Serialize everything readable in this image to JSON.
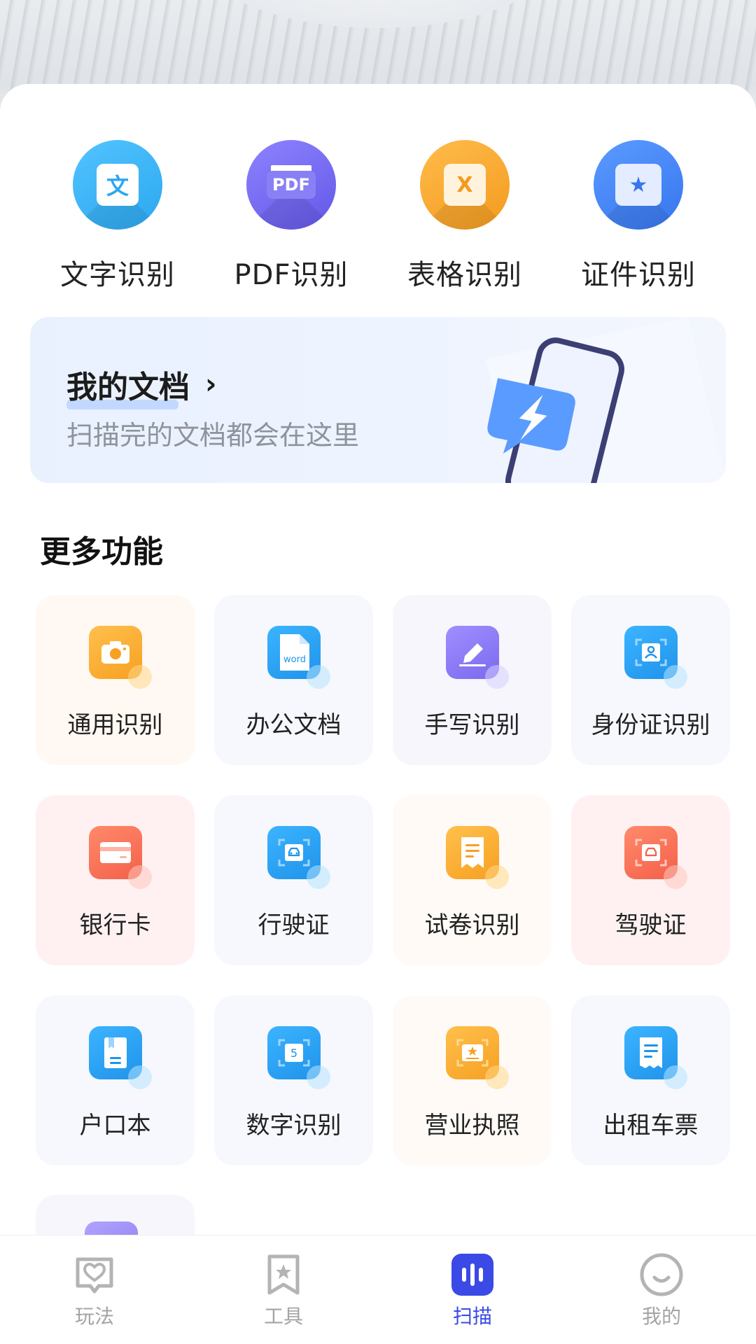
{
  "top_actions": [
    {
      "label": "文字识别",
      "icon": "text-recognition-icon",
      "glyph": "文",
      "color": "#2ca7f0"
    },
    {
      "label": "PDF识别",
      "icon": "pdf-recognition-icon",
      "glyph": "PDF",
      "color": "#6357e6"
    },
    {
      "label": "表格识别",
      "icon": "table-recognition-icon",
      "glyph": "X",
      "color": "#f39a1e"
    },
    {
      "label": "证件识别",
      "icon": "id-recognition-icon",
      "glyph": "★",
      "color": "#3675ee"
    }
  ],
  "my_docs": {
    "title": "我的文档",
    "chevron": "›",
    "subtitle": "扫描完的文档都会在这里"
  },
  "more_section": {
    "title": "更多功能",
    "items": [
      {
        "label": "通用识别",
        "icon": "camera-icon"
      },
      {
        "label": "办公文档",
        "icon": "word-document-icon",
        "badge": "word"
      },
      {
        "label": "手写识别",
        "icon": "pen-edit-icon"
      },
      {
        "label": "身份证识别",
        "icon": "id-card-icon"
      },
      {
        "label": "银行卡",
        "icon": "bank-card-icon"
      },
      {
        "label": "行驶证",
        "icon": "vehicle-license-icon"
      },
      {
        "label": "试卷识别",
        "icon": "exam-paper-icon"
      },
      {
        "label": "驾驶证",
        "icon": "driver-license-icon"
      },
      {
        "label": "户口本",
        "icon": "household-book-icon"
      },
      {
        "label": "数字识别",
        "icon": "number-recognition-icon",
        "badge": "5"
      },
      {
        "label": "营业执照",
        "icon": "business-license-icon"
      },
      {
        "label": "出租车票",
        "icon": "taxi-receipt-icon"
      }
    ]
  },
  "bottom_nav": [
    {
      "label": "玩法",
      "icon": "heart-message-icon",
      "active": false
    },
    {
      "label": "工具",
      "icon": "star-bookmark-icon",
      "active": false
    },
    {
      "label": "扫描",
      "icon": "scan-waveform-icon",
      "active": true
    },
    {
      "label": "我的",
      "icon": "smile-profile-icon",
      "active": false
    }
  ],
  "colors": {
    "active_tab": "#3b49e6",
    "inactive_tab": "#a4a4a4"
  }
}
